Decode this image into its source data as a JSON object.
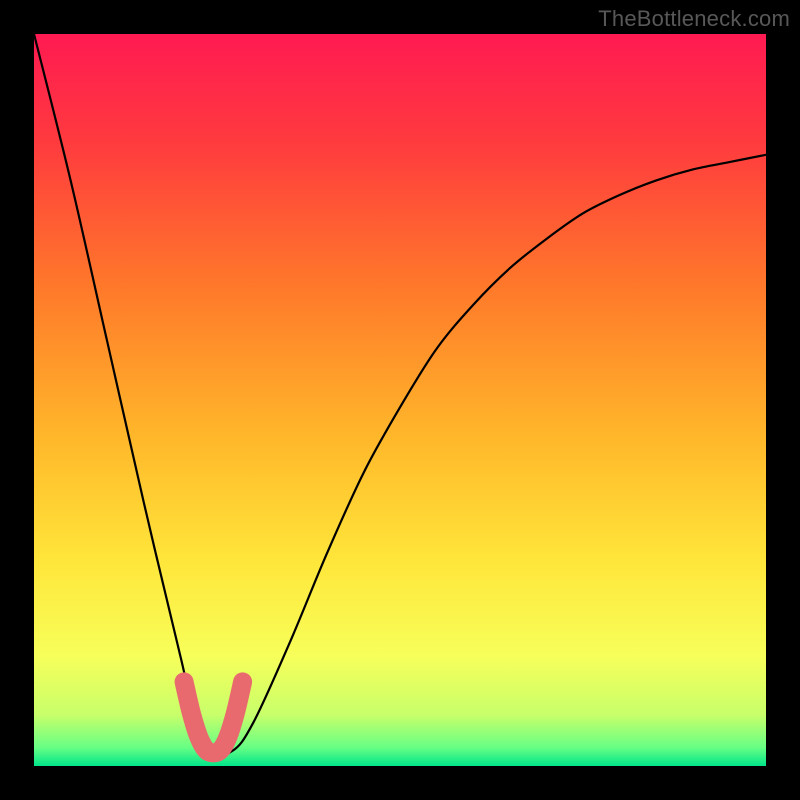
{
  "watermark": "TheBottleneck.com",
  "colors": {
    "frame": "#000000",
    "gradient_stops": [
      {
        "offset": 0.0,
        "color": "#ff1a52"
      },
      {
        "offset": 0.15,
        "color": "#ff3b3e"
      },
      {
        "offset": 0.35,
        "color": "#ff7a2a"
      },
      {
        "offset": 0.55,
        "color": "#ffb72a"
      },
      {
        "offset": 0.72,
        "color": "#ffe63a"
      },
      {
        "offset": 0.85,
        "color": "#f7ff5a"
      },
      {
        "offset": 0.93,
        "color": "#c8ff6a"
      },
      {
        "offset": 0.975,
        "color": "#66ff84"
      },
      {
        "offset": 1.0,
        "color": "#00e58a"
      }
    ],
    "curve_black": "#000000",
    "marker_pink": "#e96a6e"
  },
  "chart_data": {
    "type": "line",
    "title": "",
    "xlabel": "",
    "ylabel": "",
    "xlim": [
      0,
      1
    ],
    "ylim": [
      0,
      1
    ],
    "series": [
      {
        "name": "bottleneck-curve",
        "x": [
          0.0,
          0.05,
          0.1,
          0.15,
          0.2,
          0.233,
          0.27,
          0.3,
          0.35,
          0.4,
          0.45,
          0.5,
          0.55,
          0.6,
          0.65,
          0.7,
          0.75,
          0.8,
          0.85,
          0.9,
          0.95,
          1.0
        ],
        "y": [
          1.0,
          0.8,
          0.58,
          0.36,
          0.15,
          0.02,
          0.02,
          0.06,
          0.17,
          0.29,
          0.4,
          0.49,
          0.57,
          0.63,
          0.68,
          0.72,
          0.755,
          0.78,
          0.8,
          0.815,
          0.825,
          0.835
        ]
      },
      {
        "name": "minimum-marker",
        "x": [
          0.205,
          0.215,
          0.225,
          0.235,
          0.245,
          0.255,
          0.265,
          0.275,
          0.285
        ],
        "y": [
          0.115,
          0.072,
          0.04,
          0.022,
          0.018,
          0.022,
          0.04,
          0.072,
          0.115
        ]
      }
    ],
    "annotations": []
  }
}
